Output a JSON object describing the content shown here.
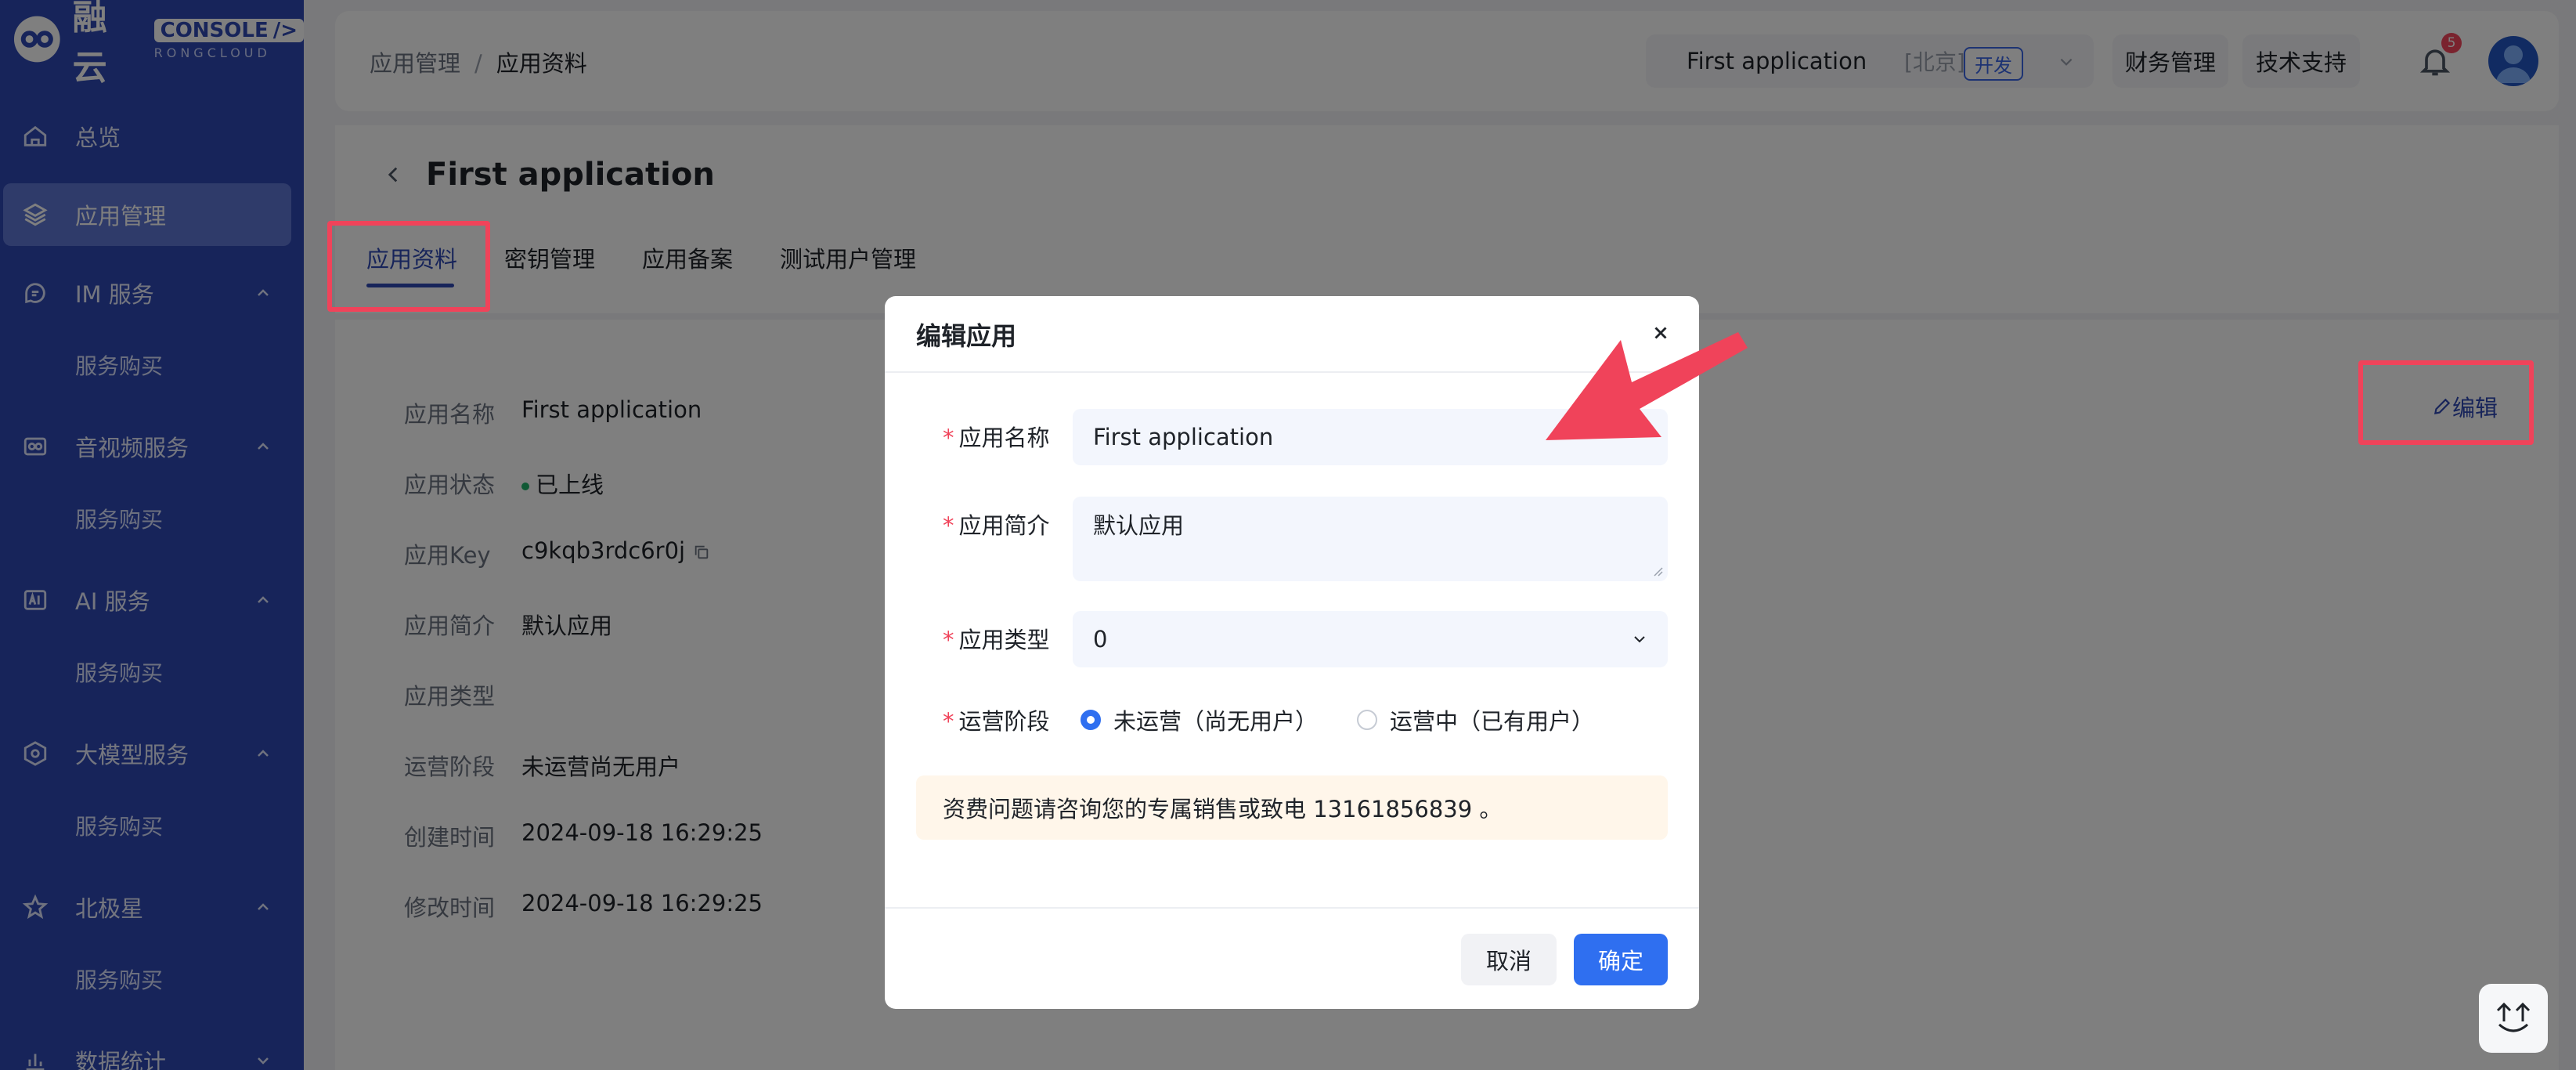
{
  "brand": {
    "name": "融云",
    "console_label": "CONSOLE",
    "sub_label": "RONGCLOUD"
  },
  "sidebar": {
    "items": [
      {
        "label": "总览",
        "icon": "home-icon"
      },
      {
        "label": "应用管理",
        "icon": "layers-icon",
        "active": true
      },
      {
        "label": "IM 服务",
        "icon": "chat-icon",
        "sub": "服务购买"
      },
      {
        "label": "音视频服务",
        "icon": "video-icon",
        "sub": "服务购买"
      },
      {
        "label": "AI 服务",
        "icon": "ai-icon",
        "sub": "服务购买"
      },
      {
        "label": "大模型服务",
        "icon": "model-icon",
        "sub": "服务购买"
      },
      {
        "label": "北极星",
        "icon": "star-icon",
        "sub": "服务购买"
      },
      {
        "label": "数据统计",
        "icon": "chart-icon"
      }
    ]
  },
  "topbar": {
    "breadcrumb": [
      "应用管理",
      "应用资料"
    ],
    "breadcrumb_sep": "/",
    "app_name": "First application",
    "region": "[北京]",
    "env": "开发",
    "finance": "财务管理",
    "support": "技术支持",
    "notifications": "5"
  },
  "page": {
    "title": "First application",
    "tabs": [
      "应用资料",
      "密钥管理",
      "应用备案",
      "测试用户管理"
    ],
    "edit_link": "编辑",
    "info": [
      {
        "label": "应用名称",
        "value": "First application"
      },
      {
        "label": "应用状态",
        "value": "已上线"
      },
      {
        "label": "应用Key",
        "value": "c9kqb3rdc6r0j"
      },
      {
        "label": "应用简介",
        "value": "默认应用"
      },
      {
        "label": "应用类型",
        "value": ""
      },
      {
        "label": "运营阶段",
        "value": "未运营尚无用户"
      },
      {
        "label": "创建时间",
        "value": "2024-09-18 16:29:25"
      },
      {
        "label": "修改时间",
        "value": "2024-09-18 16:29:25"
      }
    ]
  },
  "dialog": {
    "title": "编辑应用",
    "required_mark": "*",
    "fields": {
      "name_label": "应用名称",
      "name_value": "First application",
      "desc_label": "应用简介",
      "desc_value": "默认应用",
      "type_label": "应用类型",
      "type_value": "0",
      "stage_label": "运营阶段",
      "stage_options": [
        "未运营（尚无用户）",
        "运营中（已有用户）"
      ],
      "stage_selected": 0
    },
    "notice": "资费问题请咨询您的专属销售或致电 13161856839 。",
    "cancel": "取消",
    "confirm": "确定"
  },
  "colors": {
    "sidebar_bg": "#2f48b4",
    "primary": "#2f6ff0",
    "highlight_box": "#f0435a",
    "arrow": "#f0435a"
  }
}
